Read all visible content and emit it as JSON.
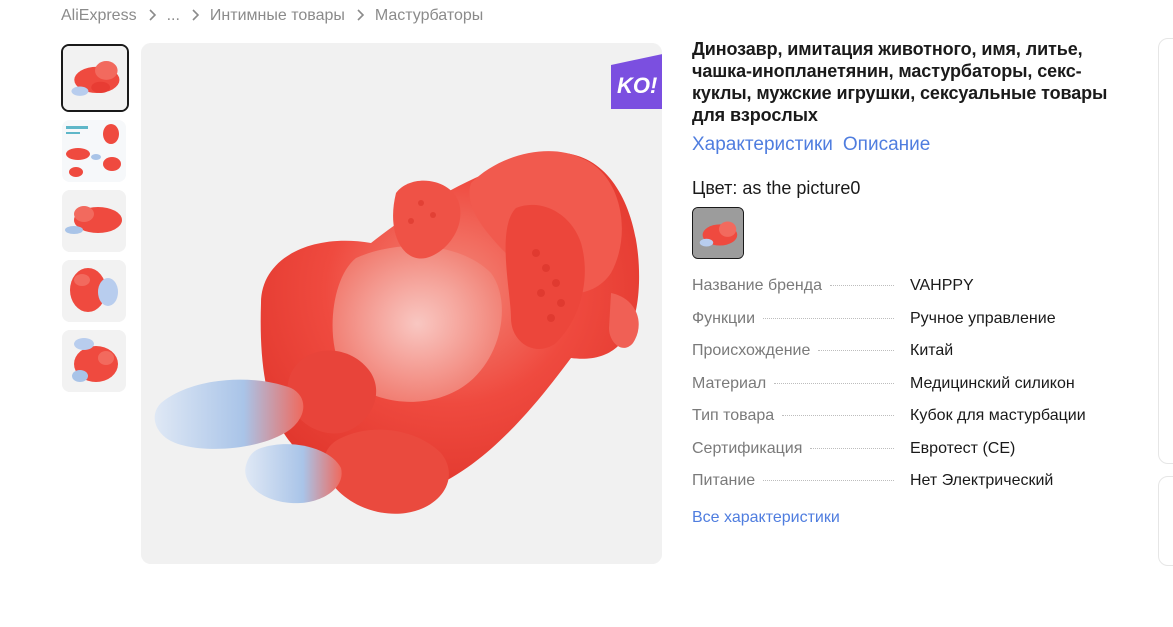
{
  "breadcrumb": {
    "items": [
      "AliExpress",
      "...",
      "Интимные товары",
      "Мастурбаторы"
    ]
  },
  "badge": {
    "text": "KO!",
    "color": "#7b4fe0"
  },
  "product": {
    "title": "Динозавр, имитация животного, имя, литье, чашка-инопланетянин, мастурбаторы, секс-куклы, мужские игрушки, сексуальные товары для взрослых",
    "tabs": [
      "Характеристики",
      "Описание"
    ],
    "color_label": "Цвет: as the picture0",
    "specs": [
      {
        "name": "Название бренда",
        "value": "VAHPPY"
      },
      {
        "name": "Функции",
        "value": "Ручное управление"
      },
      {
        "name": "Происхождение",
        "value": "Китай"
      },
      {
        "name": "Материал",
        "value": "Медицинский силикон"
      },
      {
        "name": "Тип товара",
        "value": "Кубок для мастурбации"
      },
      {
        "name": "Сертификация",
        "value": "Евротест (CE)"
      },
      {
        "name": "Питание",
        "value": "Нет Электрический"
      }
    ],
    "all_specs_link": "Все характеристики"
  },
  "colors": {
    "accent_link": "#4f7ddf",
    "product_red": "#ef4a3f",
    "product_blue": "#a9c4e8",
    "image_bg": "#f1f1f1"
  }
}
